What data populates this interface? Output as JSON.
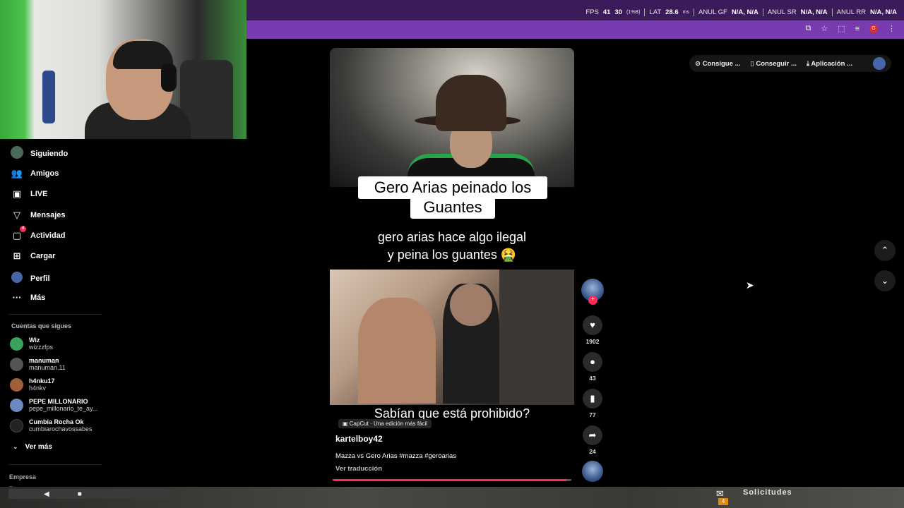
{
  "stream_overlay": {
    "fps_label": "FPS",
    "fps_value": "41",
    "fps_low": "30",
    "fps_low_detail": "(1%B)",
    "lat_label": "LAT",
    "lat_value": "28.6",
    "lat_unit": "ms",
    "anul_gf_label": "ANUL GF",
    "anul_gf_value": "N/A, N/A",
    "anul_sr_label": "ANUL SR",
    "anul_sr_value": "N/A, N/A",
    "anul_rr_label": "ANUL RR",
    "anul_rr_value": "N/A, N/A"
  },
  "browser_avatar": "G",
  "sidebar": {
    "items": [
      {
        "label": "Siguiendo",
        "icon": "following-icon"
      },
      {
        "label": "Amigos",
        "icon": "friends-icon"
      },
      {
        "label": "LIVE",
        "icon": "live-icon"
      },
      {
        "label": "Mensajes",
        "icon": "messages-icon"
      },
      {
        "label": "Actividad",
        "icon": "activity-icon",
        "badge": "4"
      },
      {
        "label": "Cargar",
        "icon": "upload-icon"
      },
      {
        "label": "Perfil",
        "icon": "profile-icon"
      },
      {
        "label": "Más",
        "icon": "more-icon"
      }
    ],
    "section_title": "Cuentas que sigues",
    "accounts": [
      {
        "name": "Wiz",
        "user": "wizzzfps",
        "color": "#3aa35a"
      },
      {
        "name": "manuman",
        "user": "manuman.11",
        "color": "#555555"
      },
      {
        "name": "h4nku17",
        "user": "h4nkv",
        "color": "#a0603a"
      },
      {
        "name": "PEPE MILLONARIO",
        "user": "pepe_millonario_te_ay...",
        "color": "#6b8ac0"
      },
      {
        "name": "Cumbia Rocha Ok",
        "user": "cumbiarochavossabes",
        "color": "#222222"
      }
    ],
    "see_more": "Ver más",
    "footer_1": "Empresa",
    "footer_2": "Programa"
  },
  "top_pill": {
    "item1": "Consigue ...",
    "item2": "Conseguir ...",
    "item3": "Aplicación ..."
  },
  "video": {
    "title_line1": "Gero Arias peinado los",
    "title_line2": "Guantes",
    "caption_line1": "gero arias hace algo ilegal",
    "caption_line2": "y peina los guantes 🤮",
    "subtitle": "Sabían que está prohibido?",
    "capcut_label": "CapCut · Una edición más fácil",
    "author": "kartelboy42",
    "description": "Mazza vs Gero Arias #mazza #geroarias",
    "translate": "Ver traducción",
    "progress": 0.98
  },
  "actions": {
    "likes": "1902",
    "comments": "43",
    "saves": "77",
    "shares": "24"
  },
  "taskbar": {
    "label": "Solicitudes",
    "badge": "4"
  },
  "colors": {
    "accent": "#fe2c55",
    "overlay_bar": "#3c1b5a",
    "browser_bar": "#7b3bb0"
  }
}
